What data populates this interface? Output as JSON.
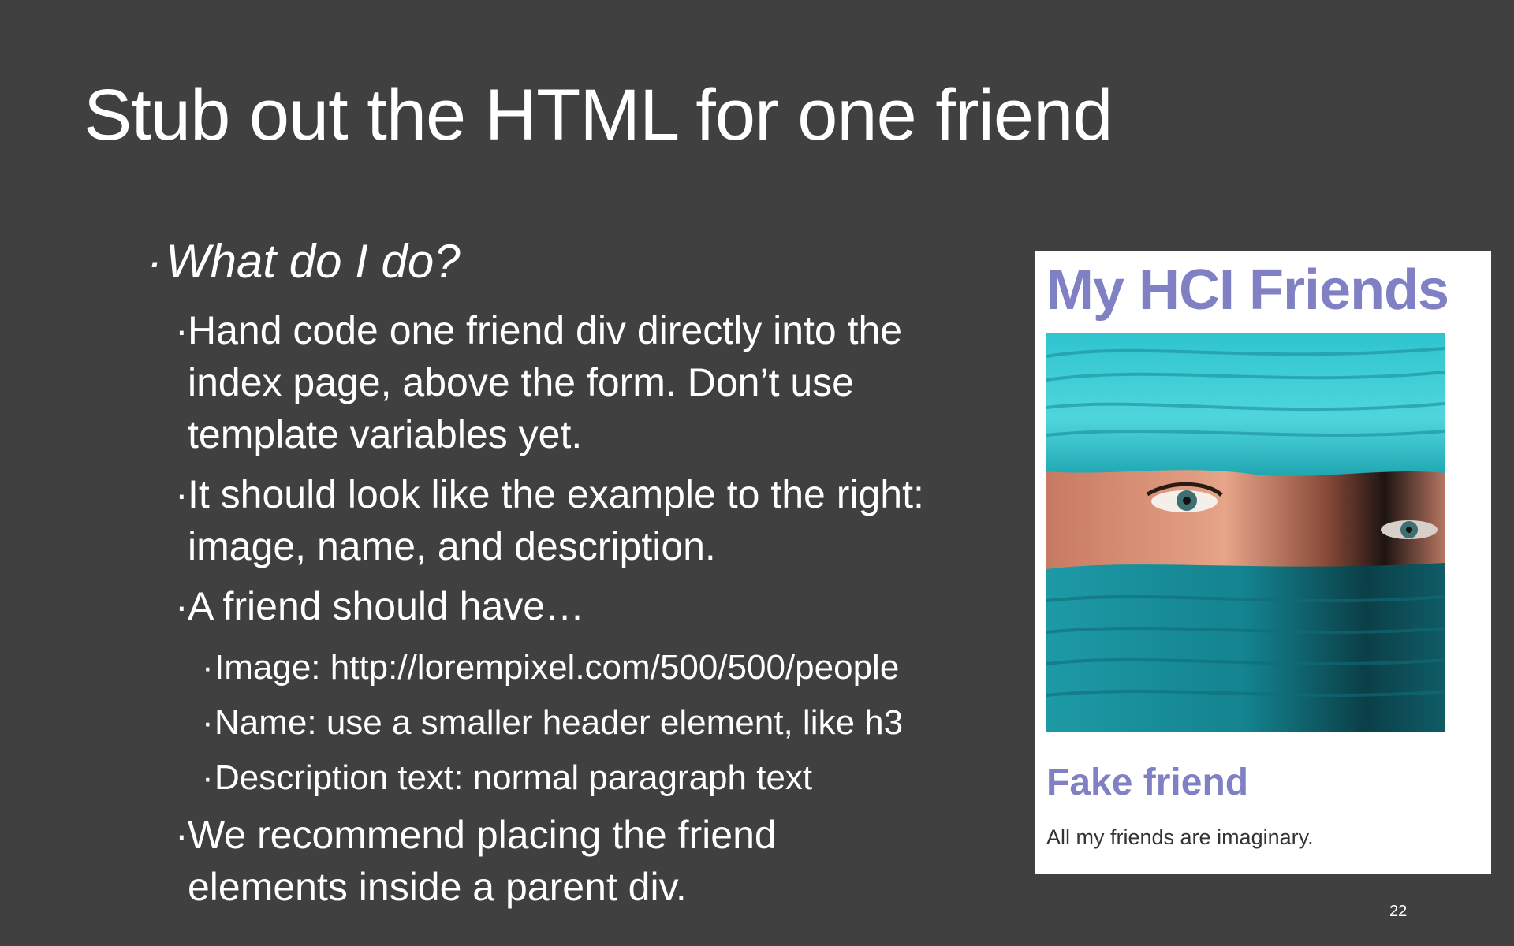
{
  "slide": {
    "title": "Stub out the HTML for one friend",
    "bullets": {
      "question": "What do I do?",
      "item1": "Hand code one friend div directly into the",
      "item1_line2": "index page, above the form. Don’t use",
      "item1_line3": "template variables yet.",
      "item2": "It should look like the example to the right:",
      "item2_line2": "image, name, and description.",
      "item3": "A friend should have…",
      "sub1": "Image: http://lorempixel.com/500/500/people",
      "sub2": "Name: use a smaller header element, like h3",
      "sub3": "Description text: normal paragraph text",
      "item4": "We recommend placing the friend",
      "item4_line2": "elements inside a parent div."
    },
    "bullet_glyph": "·",
    "page_number": "22"
  },
  "example": {
    "heading": "My HCI Friends",
    "friend_name": "Fake friend",
    "friend_description": "All my friends are imaginary.",
    "accent_color": "#8080c4"
  }
}
